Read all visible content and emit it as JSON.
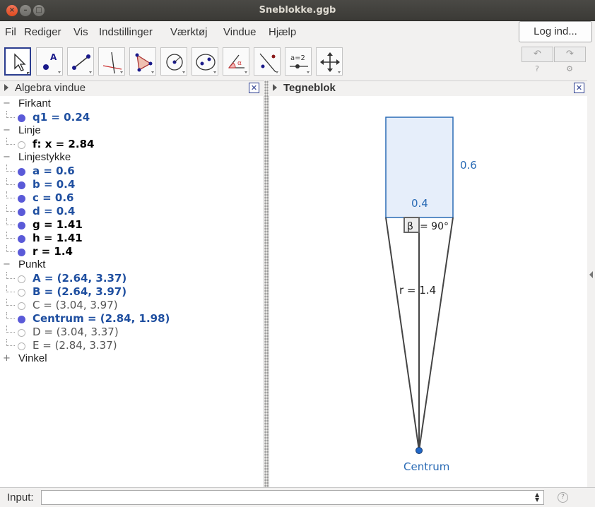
{
  "window": {
    "title": "Sneblokke.ggb"
  },
  "menu": [
    "Fil",
    "Rediger",
    "Vis",
    "Indstillinger",
    "Værktøj",
    "Vindue",
    "Hjælp"
  ],
  "login_label": "Log ind...",
  "toolbar": {
    "tools": [
      "move-tool",
      "point-tool",
      "line-tool",
      "perpendicular-tool",
      "polygon-tool",
      "circle-tool",
      "ellipse-tool",
      "angle-tool",
      "reflect-tool",
      "slider-tool",
      "move-view-tool"
    ],
    "slider_tool_text": "a=2",
    "angle_tool_text": "α",
    "undo_symbol": "↶",
    "redo_symbol": "↷",
    "help_symbol": "?",
    "settings_symbol": "⚙"
  },
  "algebra": {
    "title": "Algebra vindue",
    "groups": [
      {
        "label": "Firkant",
        "expanded": true,
        "items": [
          {
            "text": "q1 = 0.24",
            "visible": true,
            "color": "#1f4fa0"
          }
        ]
      },
      {
        "label": "Linje",
        "expanded": true,
        "items": [
          {
            "text": "f: x = 2.84",
            "visible": false,
            "color": "#000000"
          }
        ]
      },
      {
        "label": "Linjestykke",
        "expanded": true,
        "items": [
          {
            "text": "a = 0.6",
            "visible": true,
            "color": "#1f4fa0"
          },
          {
            "text": "b = 0.4",
            "visible": true,
            "color": "#1f4fa0"
          },
          {
            "text": "c = 0.6",
            "visible": true,
            "color": "#1f4fa0"
          },
          {
            "text": "d = 0.4",
            "visible": true,
            "color": "#1f4fa0"
          },
          {
            "text": "g = 1.41",
            "visible": true,
            "color": "#000000"
          },
          {
            "text": "h = 1.41",
            "visible": true,
            "color": "#000000"
          },
          {
            "text": "r = 1.4",
            "visible": true,
            "color": "#000000"
          }
        ]
      },
      {
        "label": "Punkt",
        "expanded": true,
        "items": [
          {
            "text": "A = (2.64, 3.37)",
            "visible": false,
            "color": "#1f4fa0"
          },
          {
            "text": "B = (2.64, 3.97)",
            "visible": false,
            "color": "#1f4fa0"
          },
          {
            "text": "C = (3.04, 3.97)",
            "visible": false,
            "color": "#555555"
          },
          {
            "text": "Centrum = (2.84, 1.98)",
            "visible": true,
            "color": "#1f4fa0"
          },
          {
            "text": "D = (3.04, 3.37)",
            "visible": false,
            "color": "#555555"
          },
          {
            "text": "E = (2.84, 3.37)",
            "visible": false,
            "color": "#555555"
          }
        ]
      },
      {
        "label": "Vinkel",
        "expanded": false,
        "items": []
      }
    ]
  },
  "graphics": {
    "title": "Tegneblok",
    "labels": {
      "side_right": "0.6",
      "side_bottom": "0.4",
      "angle_symbol": "β",
      "angle_value": "= 90°",
      "radius": "r = 1.4",
      "center": "Centrum"
    },
    "colors": {
      "accent": "#2a6bb5",
      "fill": "#e6eefa",
      "line": "#444444",
      "point": "#2167c7"
    }
  },
  "input": {
    "label": "Input:",
    "value": "",
    "help_symbol": "?"
  }
}
